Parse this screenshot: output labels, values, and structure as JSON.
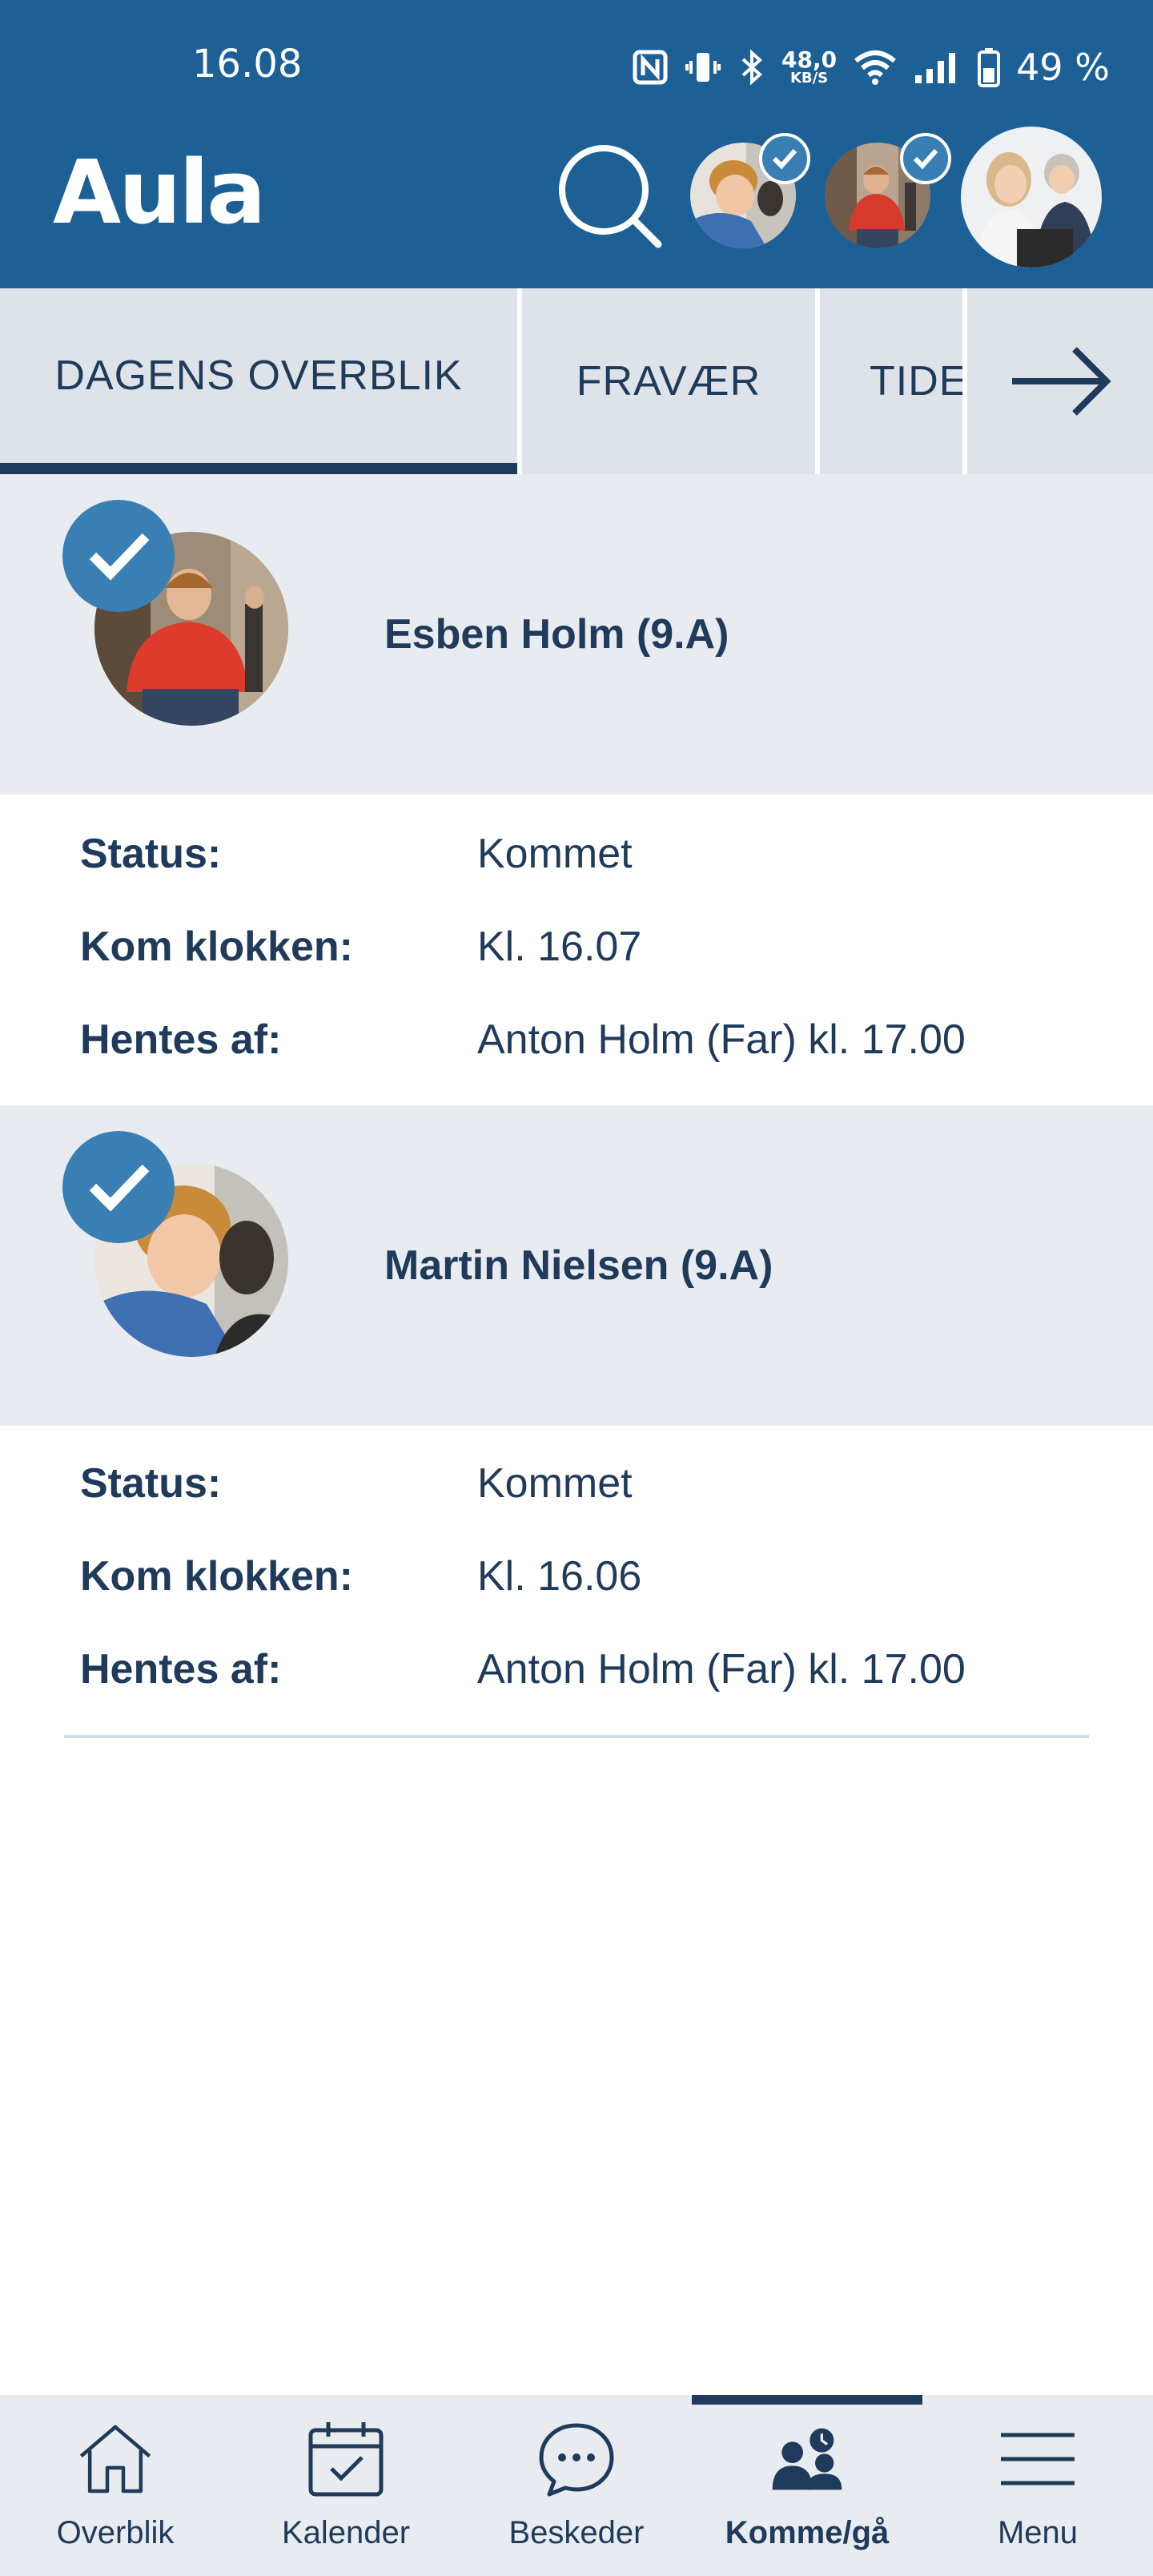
{
  "status_bar": {
    "time": "16.08",
    "speed_value": "48,0",
    "speed_unit": "KB/S",
    "battery": "49 %"
  },
  "header": {
    "logo": "Aula"
  },
  "tabs": [
    {
      "label": "DAGENS OVERBLIK",
      "active": true
    },
    {
      "label": "FRAVÆR",
      "active": false
    },
    {
      "label": "TIDE",
      "active": false
    }
  ],
  "children": [
    {
      "name": "Esben Holm (9.A)",
      "rows": [
        {
          "label": "Status:",
          "value": "Kommet"
        },
        {
          "label": "Kom klokken:",
          "value": "Kl. 16.07"
        },
        {
          "label": "Hentes af:",
          "value": "Anton Holm (Far) kl. 17.00"
        }
      ]
    },
    {
      "name": "Martin Nielsen (9.A)",
      "rows": [
        {
          "label": "Status:",
          "value": "Kommet"
        },
        {
          "label": "Kom klokken:",
          "value": "Kl. 16.06"
        },
        {
          "label": "Hentes af:",
          "value": "Anton Holm (Far) kl. 17.00"
        }
      ]
    }
  ],
  "bottom_nav": [
    {
      "label": "Overblik",
      "icon": "home-icon",
      "active": false
    },
    {
      "label": "Kalender",
      "icon": "calendar-icon",
      "active": false
    },
    {
      "label": "Beskeder",
      "icon": "chat-icon",
      "active": false
    },
    {
      "label": "Komme/gå",
      "icon": "people-clock-icon",
      "active": true
    },
    {
      "label": "Menu",
      "icon": "menu-icon",
      "active": false
    }
  ],
  "colors": {
    "header_bg": "#1c6096",
    "accent": "#3a7fb4",
    "text": "#1f3a5a"
  }
}
